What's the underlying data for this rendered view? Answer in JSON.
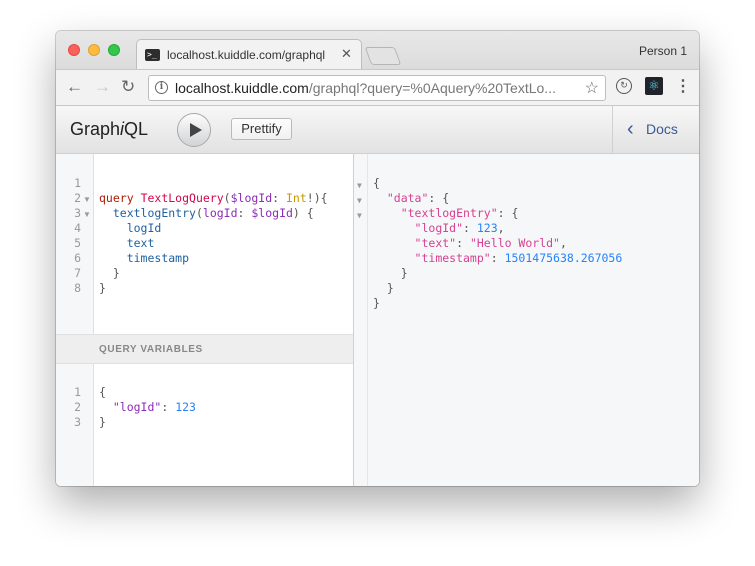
{
  "browser": {
    "tab_favicon": "terminal-icon",
    "tab_title": "localhost.kuiddle.com/graphql",
    "tab_close": "✕",
    "profile_name": "Person 1",
    "url_host": "localhost.kuiddle.com",
    "url_rest": "/graphql?query=%0Aquery%20TextLo...",
    "icons": {
      "back": "←",
      "forward": "→",
      "reload": "↻",
      "info": "i",
      "star": "☆",
      "ext_sync": "↻",
      "ext_react": "⚛",
      "menu": "⋮"
    }
  },
  "graphiql": {
    "logo_prefix": "Graph",
    "logo_italic": "i",
    "logo_suffix": "QL",
    "prettify_label": "Prettify",
    "docs_label": "Docs",
    "docs_chevron": "‹",
    "query_variables_label": "QUERY VARIABLES",
    "query_line_numbers": [
      "1",
      "2",
      "3",
      "4",
      "5",
      "6",
      "7",
      "8"
    ],
    "query": {
      "kw": "query",
      "name": "TextLogQuery",
      "var1": "$logId",
      "type": "Int",
      "field": "textlogEntry",
      "arg": "logId",
      "var2": "$logId",
      "f1": "logId",
      "f2": "text",
      "f3": "timestamp"
    },
    "variables_line_numbers": [
      "1",
      "2",
      "3"
    ],
    "variables": {
      "key": "\"logId\"",
      "value": "123"
    },
    "result": {
      "data_key": "\"data\"",
      "entry_key": "\"textlogEntry\"",
      "logId_key": "\"logId\"",
      "logId_val": "123",
      "text_key": "\"text\"",
      "text_val": "\"Hello World\"",
      "ts_key": "\"timestamp\"",
      "ts_val": "1501475638.267056"
    },
    "fold_marker": "▼"
  }
}
